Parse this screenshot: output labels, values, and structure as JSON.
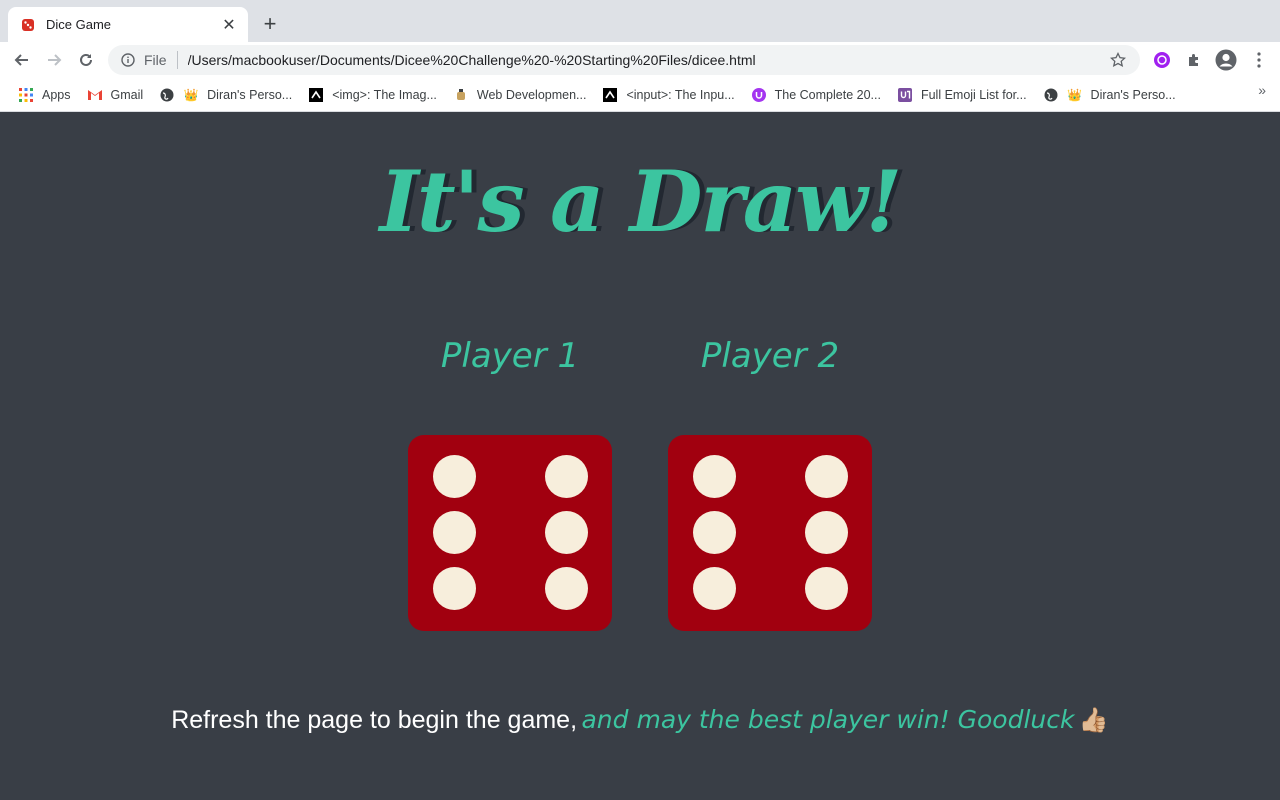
{
  "browser": {
    "tab": {
      "title": "Dice Game",
      "close_glyph": "✕"
    },
    "new_tab_glyph": "+",
    "omnibox": {
      "scheme": "File",
      "url": "/Users/macbookuser/Documents/Dicee%20Challenge%20-%20Starting%20Files/dicee.html"
    },
    "bookmarks": [
      {
        "label": "Apps",
        "icon": "apps-grid-icon"
      },
      {
        "label": "Gmail",
        "icon": "gmail-icon"
      },
      {
        "label": "Diran's Perso...",
        "icon": "crown-emoji-icon"
      },
      {
        "label": "<img>: The Imag...",
        "icon": "mdn-icon"
      },
      {
        "label": "Web Developmen...",
        "icon": "udemy-icon"
      },
      {
        "label": "<input>: The Inpu...",
        "icon": "mdn-icon"
      },
      {
        "label": "The Complete 20...",
        "icon": "udemy-purple-icon"
      },
      {
        "label": "Full Emoji List for...",
        "icon": "unicode-icon"
      },
      {
        "label": "Diran's Perso...",
        "icon": "crown-emoji-icon"
      }
    ],
    "bookmarks_more_glyph": "»"
  },
  "page": {
    "heading": "It's a Draw!",
    "player1": "Player 1",
    "player2": "Player 2",
    "dice": [
      6,
      6
    ],
    "footer": {
      "lead": "Refresh the page to begin the game,",
      "accent": "and may the best player win! Goodluck",
      "emoji": "👍🏼"
    },
    "colors": {
      "background": "#393E46",
      "accent": "#3CC5A0",
      "die": "#A1000F",
      "pip": "#F7EEDC",
      "shadow": "#222831"
    }
  }
}
